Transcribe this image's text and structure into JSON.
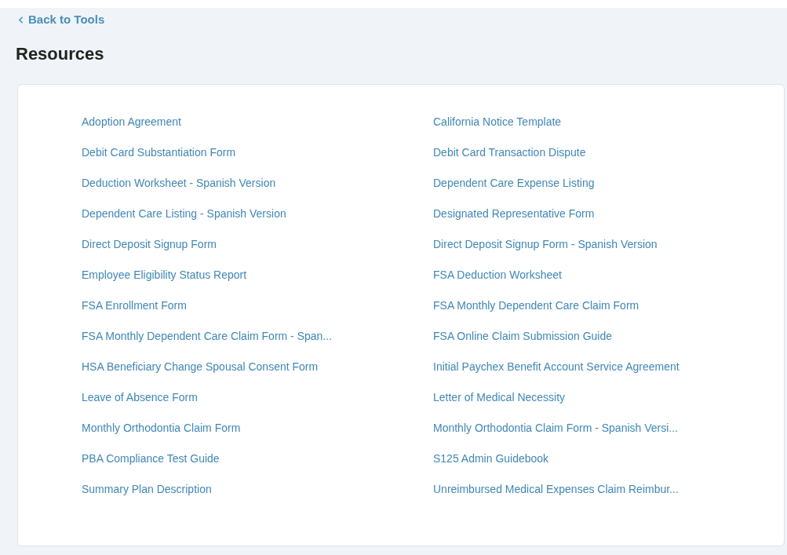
{
  "back_link": {
    "label": "Back to Tools"
  },
  "title": "Resources",
  "links": [
    "Adoption Agreement",
    "California Notice Template",
    "Debit Card Substantiation Form",
    "Debit Card Transaction Dispute",
    "Deduction Worksheet - Spanish Version",
    "Dependent Care Expense Listing",
    "Dependent Care Listing - Spanish Version",
    "Designated Representative Form",
    "Direct Deposit Signup Form",
    "Direct Deposit Signup Form - Spanish Version",
    "Employee Eligibility Status Report",
    "FSA Deduction Worksheet",
    "FSA Enrollment Form",
    "FSA Monthly Dependent Care Claim Form",
    "FSA Monthly Dependent Care Claim Form - Span...",
    "FSA Online Claim Submission Guide",
    "HSA Beneficiary Change Spousal Consent Form",
    "Initial Paychex Benefit Account Service Agreement",
    "Leave of Absence Form",
    "Letter of Medical Necessity",
    "Monthly Orthodontia Claim Form",
    "Monthly Orthodontia Claim Form - Spanish Versi...",
    "PBA Compliance Test Guide",
    "S125 Admin Guidebook",
    "Summary Plan Description",
    "Unreimbursed Medical Expenses Claim Reimbur..."
  ]
}
